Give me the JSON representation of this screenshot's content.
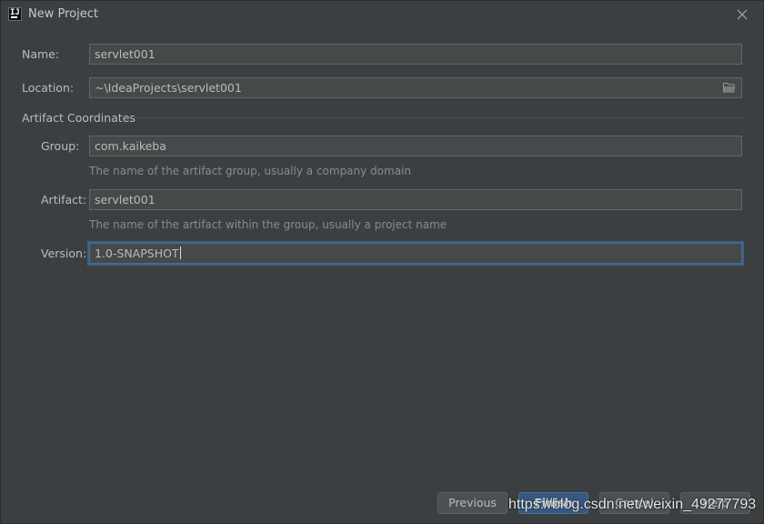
{
  "window": {
    "title": "New Project"
  },
  "form": {
    "name_label": "Name:",
    "name_value": "servlet001",
    "location_label": "Location:",
    "location_value": "~\\IdeaProjects\\servlet001",
    "section_title": "Artifact Coordinates",
    "group_label": "Group:",
    "group_value": "com.kaikeba",
    "group_hint": "The name of the artifact group, usually a company domain",
    "artifact_label": "Artifact:",
    "artifact_value": "servlet001",
    "artifact_hint": "The name of the artifact within the group, usually a project name",
    "version_label": "Version:",
    "version_value": "1.0-SNAPSHOT"
  },
  "buttons": {
    "previous": "Previous",
    "finish": "Finish",
    "cancel": "Cancel",
    "help": "Help"
  },
  "watermark": "https://blog.csdn.net/weixin_49277793",
  "icons": {
    "app": "intellij-idea-icon",
    "close": "close-icon",
    "browse": "folder-icon"
  },
  "colors": {
    "background": "#3c3f41",
    "field_bg": "#45494a",
    "focus": "#466d94",
    "primary_button": "#365880"
  }
}
